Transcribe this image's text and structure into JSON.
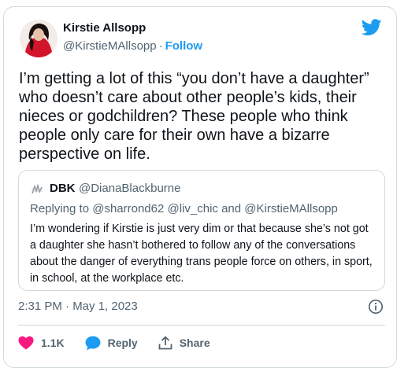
{
  "author": {
    "name": "Kirstie Allsopp",
    "handle": "@KirstieMAllsopp",
    "separator": "·",
    "follow_label": "Follow"
  },
  "tweet": {
    "text": "I’m getting a lot of this “you don’t have a daughter” who doesn’t care about other people’s kids, their nieces or godchildren? These people who think people only care for their own have a bizarre perspective on life."
  },
  "quote": {
    "name": "DBK",
    "handle": "@DianaBlackburne",
    "reply_prefix": "Replying to",
    "reply_mentions": "@sharrond62 @liv_chic and @KirstieMAllsopp",
    "text": "I’m wondering if Kirstie is just very dim or that because she’s not got a daughter she hasn’t bothered to follow any of the conversations about the danger of everything trans people force on others, in sport, in school, at the workplace etc."
  },
  "meta": {
    "timestamp": "2:31 PM · May 1, 2023"
  },
  "actions": {
    "like_count": "1.1K",
    "reply_label": "Reply",
    "share_label": "Share"
  },
  "colors": {
    "accent": "#1d9bf0",
    "like": "#f91880",
    "text": "#0f1419",
    "secondary": "#536471",
    "border": "#cfd9de"
  },
  "icons": [
    "twitter-bird-icon",
    "info-icon",
    "heart-icon",
    "reply-bubble-icon",
    "share-icon"
  ]
}
